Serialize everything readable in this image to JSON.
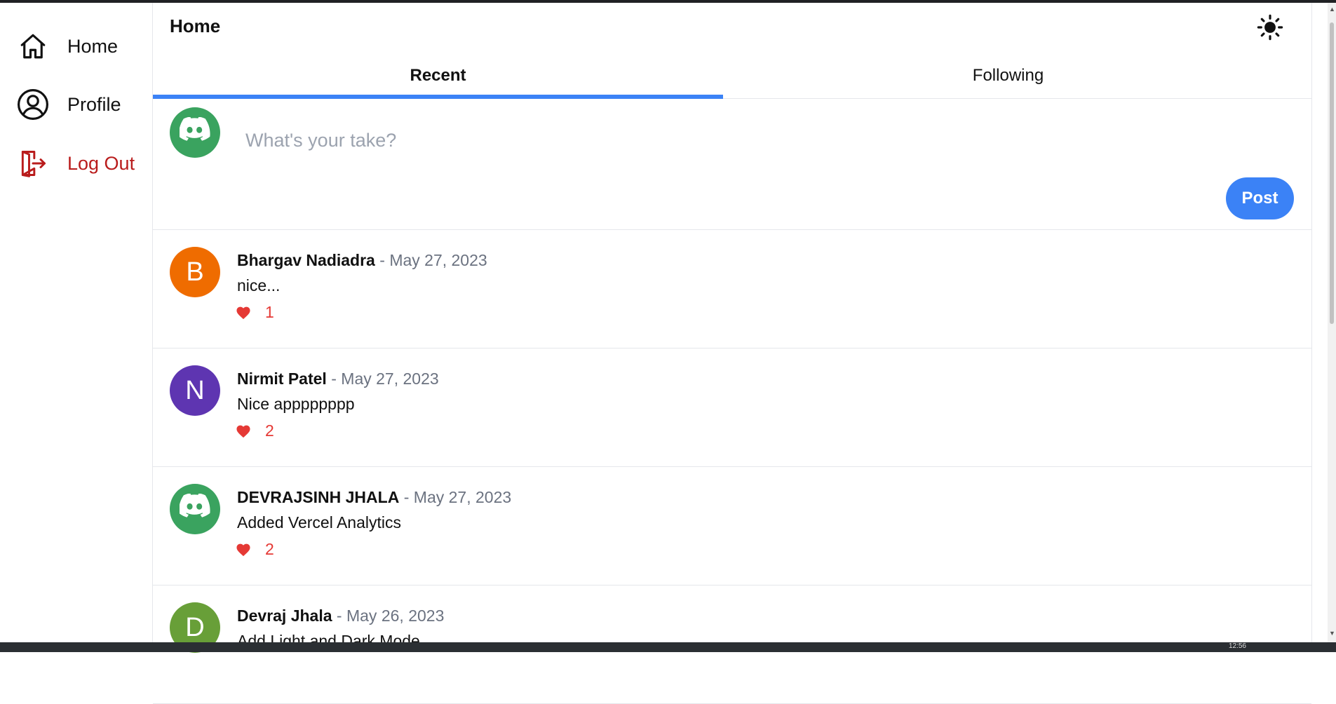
{
  "sidebar": {
    "items": [
      {
        "label": "Home",
        "icon": "home-icon"
      },
      {
        "label": "Profile",
        "icon": "user-circle-icon"
      },
      {
        "label": "Log Out",
        "icon": "logout-icon",
        "color": "#b91c1c"
      }
    ]
  },
  "header": {
    "title": "Home",
    "theme_icon": "sun-icon"
  },
  "tabs": [
    {
      "label": "Recent",
      "active": true
    },
    {
      "label": "Following",
      "active": false
    }
  ],
  "composer": {
    "placeholder": "What's your take?",
    "post_label": "Post",
    "avatar_icon": "discord-icon"
  },
  "posts": [
    {
      "initial": "B",
      "avatar_color": "#ef6c00",
      "author": "Bhargav Nadiadra",
      "separator": "-",
      "date": "May 27, 2023",
      "text": "nice...",
      "likes": "1"
    },
    {
      "initial": "N",
      "avatar_color": "#5e35b1",
      "author": "Nirmit Patel",
      "separator": "-",
      "date": "May 27, 2023",
      "text": "Nice apppppppp",
      "likes": "2"
    },
    {
      "initial": "",
      "avatar_icon": "discord-icon",
      "avatar_color": "#3aa35f",
      "author": "DEVRAJSINH JHALA",
      "separator": "-",
      "date": "May 27, 2023",
      "text": "Added Vercel Analytics",
      "likes": "2"
    },
    {
      "initial": "D",
      "avatar_color": "#689f38",
      "author": "Devraj Jhala",
      "separator": "-",
      "date": "May 26, 2023",
      "text": "Add Light and Dark Mode",
      "likes": ""
    }
  ],
  "colors": {
    "accent": "#3b82f6",
    "like": "#e53935",
    "logout": "#b91c1c"
  },
  "taskbar": {
    "clock": "12:56"
  }
}
